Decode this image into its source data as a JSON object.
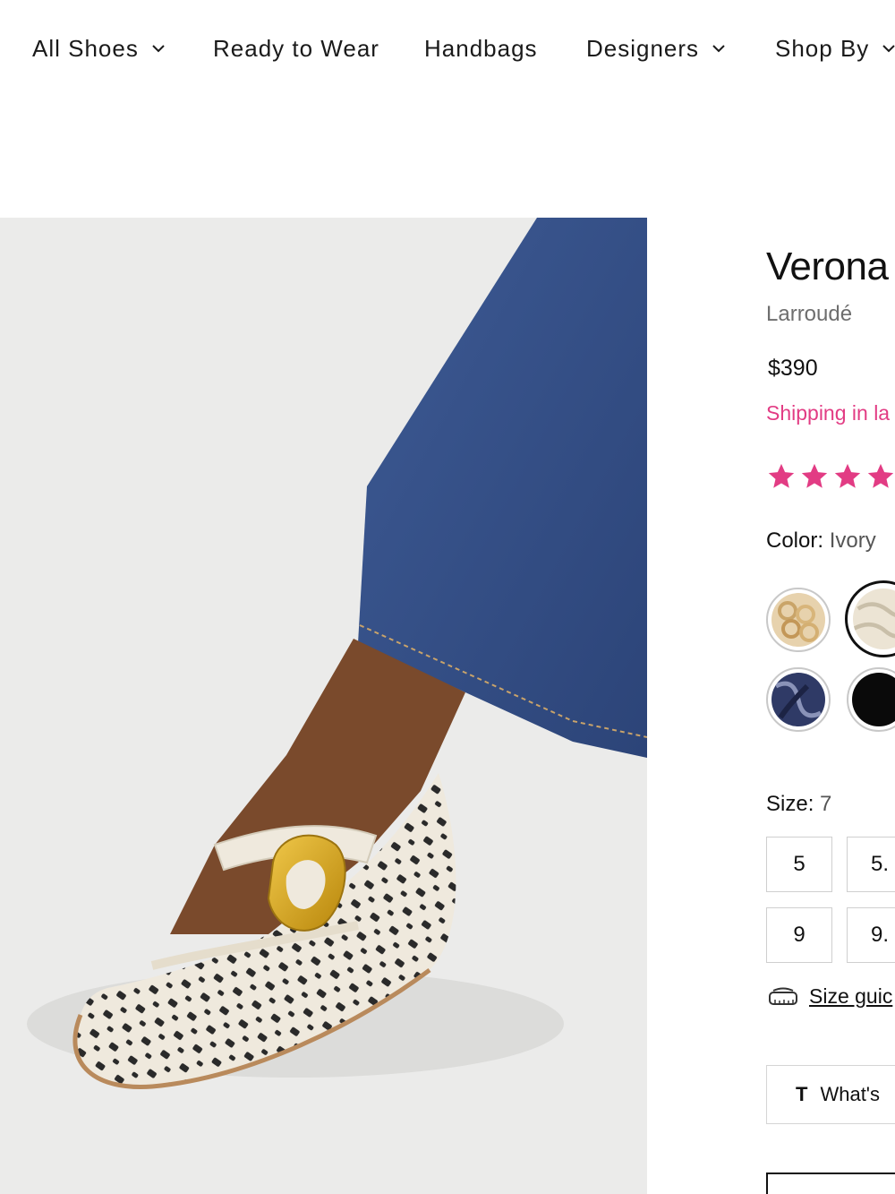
{
  "nav": {
    "items": [
      {
        "label": "All Shoes",
        "has_dropdown": true
      },
      {
        "label": "Ready to Wear",
        "has_dropdown": false
      },
      {
        "label": "Handbags",
        "has_dropdown": false
      },
      {
        "label": "Designers",
        "has_dropdown": true
      },
      {
        "label": "Shop By",
        "has_dropdown": true
      }
    ]
  },
  "product": {
    "title": "Verona",
    "brand": "Larroudé",
    "price": "$390",
    "shipping": "Shipping in la",
    "rating": {
      "stars_shown": 4,
      "color": "#e23c84"
    },
    "color_label": "Color:",
    "color_value": "Ivory",
    "swatches": [
      {
        "name": "gold-chain-swatch",
        "color": "#d9b98c",
        "selected": false
      },
      {
        "name": "ivory-swatch",
        "color": "#e9e2d3",
        "selected": true
      },
      {
        "name": "navy-print-swatch",
        "color": "#2f3a66",
        "selected": false
      },
      {
        "name": "black-swatch",
        "color": "#0a0a0a",
        "selected": false
      }
    ],
    "size_label": "Size:",
    "size_value": "7",
    "sizes": [
      "5",
      "5.",
      "9",
      "9."
    ],
    "size_guide": "Size guic",
    "whats_label": "What's",
    "whats_icon": "T"
  },
  "colors": {
    "accent": "#e23c84",
    "text": "#1a1a1a",
    "muted": "#6e6e6e",
    "hero_bg": "#ebebea",
    "denim": "#34518a",
    "skin": "#7a4a2c",
    "shoe": "#efe9dd",
    "buckle": "#d4a52e"
  }
}
